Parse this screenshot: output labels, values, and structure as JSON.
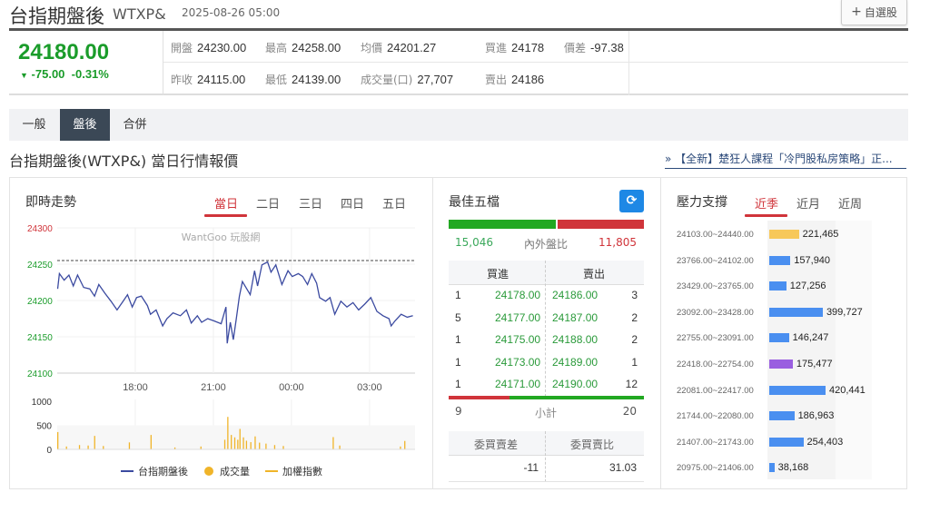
{
  "header": {
    "title": "台指期盤後",
    "code": "WTXP&",
    "datetime": "2025-08-26 05:00",
    "fav_button": "自選股",
    "fav_icon": "plus-icon"
  },
  "quote": {
    "price": "24180.00",
    "change": "-75.00",
    "change_pct": "-0.31%",
    "direction_icon": "triangle-down-icon",
    "fields": [
      {
        "label": "開盤",
        "value": "24230.00"
      },
      {
        "label": "最高",
        "value": "24258.00"
      },
      {
        "label": "均價",
        "value": "24201.27"
      },
      {
        "label": "買進",
        "value": "24178"
      },
      {
        "label": "價差",
        "value": "-97.38"
      },
      {
        "label": "昨收",
        "value": "24115.00"
      },
      {
        "label": "最低",
        "value": "24139.00"
      },
      {
        "label": "成交量(口)",
        "value": "27,707"
      },
      {
        "label": "賣出",
        "value": "24186"
      }
    ]
  },
  "tabs": [
    {
      "label": "一般"
    },
    {
      "label": "盤後",
      "active": true
    },
    {
      "label": "合併"
    }
  ],
  "section_title": "台指期盤後(WTXP&) 當日行情報價",
  "promo_link": "» 【全新】楚狂人課程「冷門股私房策略」正...",
  "colors": {
    "up": "#d0343a",
    "down": "#1a9c2a",
    "line": "#3b4aa0",
    "volume": "#f0b429",
    "resistance": "#f7c85a",
    "support": "#4a8ff0",
    "current": "#9a5fe0"
  },
  "trend": {
    "title": "即時走勢",
    "day_tabs": [
      "當日",
      "二日",
      "三日",
      "四日",
      "五日"
    ],
    "active_day": "當日",
    "watermark": "WantGoo 玩股網",
    "legend": [
      {
        "label": "台指期盤後",
        "icon": "line"
      },
      {
        "label": "成交量",
        "icon": "dot"
      },
      {
        "label": "加權指數",
        "icon": "line"
      }
    ]
  },
  "chart_data": {
    "type": "line",
    "xlim": [
      "15:00",
      "04:45"
    ],
    "x_ticks": [
      "18:00",
      "21:00",
      "00:00",
      "03:00"
    ],
    "ylim": [
      24100,
      24300
    ],
    "y_ticks": [
      "24300",
      "24250",
      "24200",
      "24150",
      "24100"
    ],
    "reference": 24255,
    "series": [
      {
        "name": "台指期盤後",
        "points": [
          [
            "15:01",
            24216
          ],
          [
            "15:05",
            24237
          ],
          [
            "15:16",
            24228
          ],
          [
            "15:27",
            24235
          ],
          [
            "15:37",
            24220
          ],
          [
            "15:47",
            24235
          ],
          [
            "16:01",
            24218
          ],
          [
            "16:15",
            24216
          ],
          [
            "16:26",
            24206
          ],
          [
            "16:36",
            24222
          ],
          [
            "16:50",
            24210
          ],
          [
            "17:04",
            24199
          ],
          [
            "17:18",
            24187
          ],
          [
            "17:32",
            24199
          ],
          [
            "17:42",
            24208
          ],
          [
            "17:53",
            24191
          ],
          [
            "18:03",
            24204
          ],
          [
            "18:14",
            24206
          ],
          [
            "18:28",
            24193
          ],
          [
            "18:35",
            24181
          ],
          [
            "18:48",
            24187
          ],
          [
            "19:03",
            24165
          ],
          [
            "19:13",
            24175
          ],
          [
            "19:27",
            24183
          ],
          [
            "19:44",
            24179
          ],
          [
            "19:58",
            24187
          ],
          [
            "20:09",
            24169
          ],
          [
            "20:23",
            24179
          ],
          [
            "20:33",
            24170
          ],
          [
            "20:47",
            24175
          ],
          [
            "21:01",
            24172
          ],
          [
            "21:18",
            24168
          ],
          [
            "21:29",
            24191
          ],
          [
            "21:32",
            24141
          ],
          [
            "21:39",
            24170
          ],
          [
            "21:46",
            24146
          ],
          [
            "21:53",
            24175
          ],
          [
            "22:00",
            24206
          ],
          [
            "22:07",
            24226
          ],
          [
            "22:17",
            24216
          ],
          [
            "22:25",
            24208
          ],
          [
            "22:35",
            24241
          ],
          [
            "22:42",
            24220
          ],
          [
            "22:52",
            24249
          ],
          [
            "23:05",
            24253
          ],
          [
            "23:13",
            24239
          ],
          [
            "23:24",
            24249
          ],
          [
            "23:38",
            24222
          ],
          [
            "23:52",
            24241
          ],
          [
            "00:02",
            24233
          ],
          [
            "00:16",
            24237
          ],
          [
            "00:26",
            24233
          ],
          [
            "00:37",
            24222
          ],
          [
            "00:47",
            24237
          ],
          [
            "00:58",
            24224
          ],
          [
            "01:05",
            24204
          ],
          [
            "01:19",
            24199
          ],
          [
            "01:29",
            24204
          ],
          [
            "01:40",
            24181
          ],
          [
            "01:54",
            24199
          ],
          [
            "02:08",
            24191
          ],
          [
            "02:22",
            24197
          ],
          [
            "02:35",
            24187
          ],
          [
            "02:49",
            24195
          ],
          [
            "03:03",
            24204
          ],
          [
            "03:17",
            24185
          ],
          [
            "03:31",
            24179
          ],
          [
            "03:45",
            24175
          ],
          [
            "03:50",
            24165
          ],
          [
            "03:59",
            24172
          ],
          [
            "04:13",
            24181
          ],
          [
            "04:27",
            24177
          ],
          [
            "04:40",
            24179
          ]
        ]
      }
    ],
    "volume": {
      "ylim": [
        0,
        1000
      ],
      "y_ticks": [
        "1000",
        "500",
        "0"
      ],
      "bars": [
        [
          "15:00",
          360
        ],
        [
          "15:20",
          60
        ],
        [
          "15:50",
          90
        ],
        [
          "16:10",
          80
        ],
        [
          "16:25",
          280
        ],
        [
          "16:45",
          70
        ],
        [
          "17:45",
          145
        ],
        [
          "18:35",
          300
        ],
        [
          "19:30",
          40
        ],
        [
          "20:30",
          60
        ],
        [
          "21:25",
          200
        ],
        [
          "21:32",
          675
        ],
        [
          "21:40",
          300
        ],
        [
          "21:48",
          250
        ],
        [
          "21:55",
          200
        ],
        [
          "22:00",
          425
        ],
        [
          "22:08",
          250
        ],
        [
          "22:15",
          180
        ],
        [
          "22:25",
          150
        ],
        [
          "22:35",
          270
        ],
        [
          "22:45",
          140
        ],
        [
          "23:00",
          120
        ],
        [
          "23:20",
          90
        ],
        [
          "23:40",
          70
        ],
        [
          "01:35",
          255
        ],
        [
          "01:50",
          80
        ],
        [
          "04:10",
          60
        ],
        [
          "04:20",
          175
        ]
      ]
    }
  },
  "best_five": {
    "title": "最佳五檔",
    "refresh_icon": "refresh-icon",
    "inner": "15,046",
    "outer": "11,805",
    "inner_outer_label": "內外盤比",
    "inner_ratio": 0.56,
    "bid_header": "買進",
    "ask_header": "賣出",
    "rows": [
      {
        "bid_vol": "1",
        "bid": "24178.00",
        "ask": "24186.00",
        "ask_vol": "3"
      },
      {
        "bid_vol": "5",
        "bid": "24177.00",
        "ask": "24187.00",
        "ask_vol": "2"
      },
      {
        "bid_vol": "1",
        "bid": "24175.00",
        "ask": "24188.00",
        "ask_vol": "2"
      },
      {
        "bid_vol": "1",
        "bid": "24173.00",
        "ask": "24189.00",
        "ask_vol": "1"
      },
      {
        "bid_vol": "1",
        "bid": "24171.00",
        "ask": "24190.00",
        "ask_vol": "12"
      }
    ],
    "subtotal_label": "小計",
    "bid_total": "9",
    "ask_total": "20",
    "bid_total_ratio": 0.31,
    "diff_header": "委買賣差",
    "ratio_header": "委買賣比",
    "diff": "-11",
    "ratio": "31.03"
  },
  "pressure": {
    "title": "壓力支撐",
    "tabs": [
      "近季",
      "近月",
      "近周"
    ],
    "active": "近季",
    "rows": [
      {
        "range": "24103.00~24440.00",
        "value": 221465,
        "label": "221,465",
        "kind": "resistance"
      },
      {
        "range": "23766.00~24102.00",
        "value": 157940,
        "label": "157,940",
        "kind": "support"
      },
      {
        "range": "23429.00~23765.00",
        "value": 127256,
        "label": "127,256",
        "kind": "support"
      },
      {
        "range": "23092.00~23428.00",
        "value": 399727,
        "label": "399,727",
        "kind": "support"
      },
      {
        "range": "22755.00~23091.00",
        "value": 146247,
        "label": "146,247",
        "kind": "support"
      },
      {
        "range": "22418.00~22754.00",
        "value": 175477,
        "label": "175,477",
        "kind": "current"
      },
      {
        "range": "22081.00~22417.00",
        "value": 420441,
        "label": "420,441",
        "kind": "support"
      },
      {
        "range": "21744.00~22080.00",
        "value": 186963,
        "label": "186,963",
        "kind": "support"
      },
      {
        "range": "21407.00~21743.00",
        "value": 254403,
        "label": "254,403",
        "kind": "support"
      },
      {
        "range": "20975.00~21406.00",
        "value": 38168,
        "label": "38,168",
        "kind": "support"
      }
    ]
  }
}
